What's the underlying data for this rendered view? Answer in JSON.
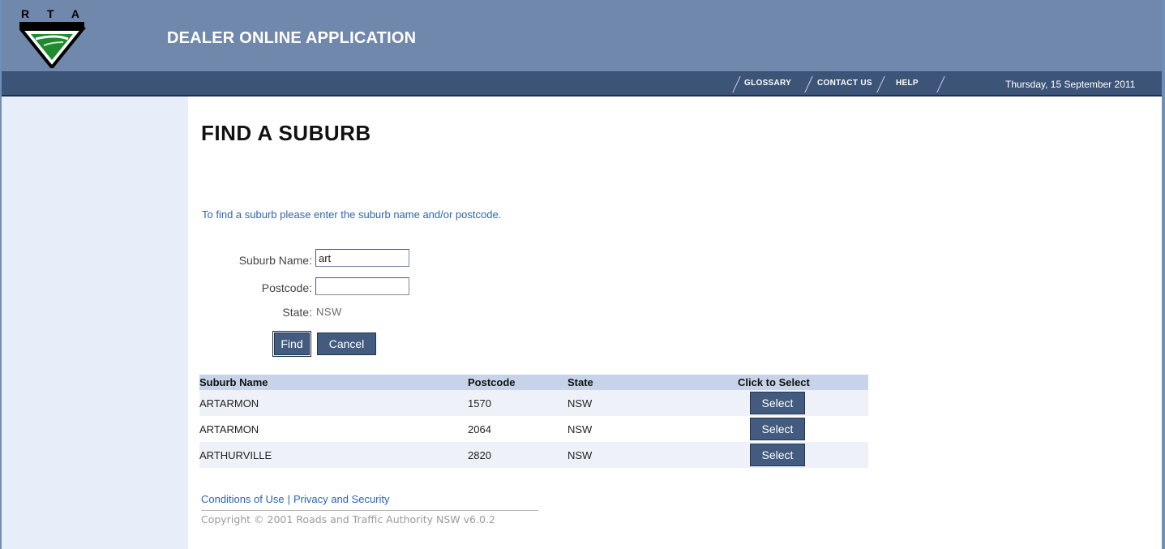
{
  "header": {
    "logo_text": "R T A",
    "app_title": "DEALER ONLINE APPLICATION"
  },
  "nav": {
    "links": [
      "GLOSSARY",
      "CONTACT US",
      "HELP"
    ],
    "date": "Thursday, 15 September 2011"
  },
  "page": {
    "title": "FIND A SUBURB",
    "intro": "To find a suburb please enter the suburb name and/or postcode."
  },
  "form": {
    "suburb_label": "Suburb Name:",
    "suburb_value": "art",
    "postcode_label": "Postcode:",
    "postcode_value": "",
    "state_label": "State:",
    "state_value": "NSW",
    "find_label": "Find",
    "cancel_label": "Cancel"
  },
  "results": {
    "headers": [
      "Suburb Name",
      "Postcode",
      "State",
      "Click to Select"
    ],
    "rows": [
      {
        "suburb": "ARTARMON",
        "postcode": "1570",
        "state": "NSW",
        "action": "Select"
      },
      {
        "suburb": "ARTARMON",
        "postcode": "2064",
        "state": "NSW",
        "action": "Select"
      },
      {
        "suburb": "ARTHURVILLE",
        "postcode": "2820",
        "state": "NSW",
        "action": "Select"
      }
    ]
  },
  "footer": {
    "conditions": "Conditions of Use",
    "separator": "|",
    "privacy": "Privacy and Security",
    "copyright": "Copyright © 2001 Roads and Traffic Authority NSW v6.0.2"
  },
  "colors": {
    "header_bg": "#7088ab",
    "nav_bg": "#3d5479",
    "button_bg": "#425b7f",
    "link": "#2e63b5",
    "sidebar_bg": "#e8eef9"
  }
}
